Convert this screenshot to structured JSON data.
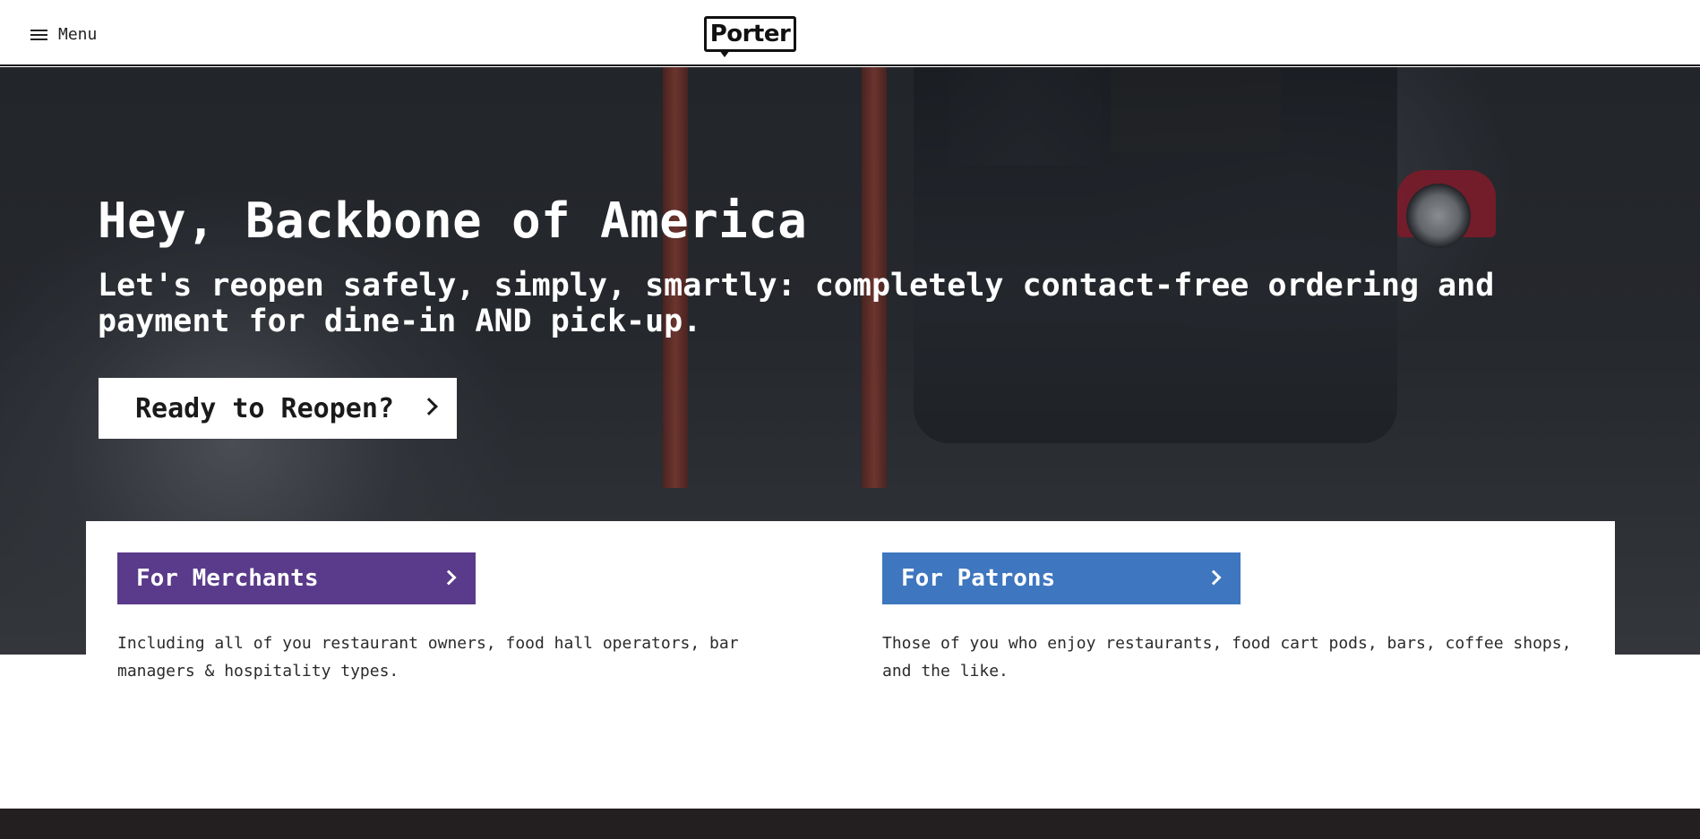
{
  "header": {
    "menu_label": "Menu",
    "logo_text": "Porter"
  },
  "hero": {
    "title": "Hey, Backbone of America",
    "subtitle": "Let's reopen safely, simply, smartly: completely contact-free ordering and payment for dine-in AND pick-up.",
    "cta_label": "Ready to Reopen?"
  },
  "audiences": {
    "merchants": {
      "label": "For Merchants",
      "description": "Including all of you restaurant owners, food hall operators, bar managers & hospitality types.",
      "color": "#5a3a8a"
    },
    "patrons": {
      "label": "For Patrons",
      "description": "Those of you who enjoy restaurants, food cart pods, bars, coffee shops, and the like.",
      "color": "#3e76bf"
    }
  },
  "icons": {
    "menu": "hamburger-icon",
    "chevron": "chevron-right-icon"
  }
}
